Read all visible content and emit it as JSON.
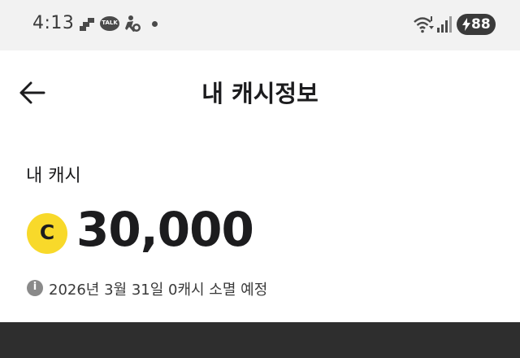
{
  "status_bar": {
    "time": "4:13",
    "talk_badge": "TALK",
    "battery": "88",
    "icons": [
      "blocks-icon",
      "kakaotalk-icon",
      "accessibility-icon",
      "notification-dot-icon",
      "wifi-icon",
      "signal-icon",
      "battery-charging-icon"
    ]
  },
  "header": {
    "title": "내 캐시정보",
    "back_icon": "arrow-left-icon"
  },
  "cash": {
    "label": "내 캐시",
    "coin_symbol": "C",
    "amount": "30,000",
    "coin_color": "#f8d92a"
  },
  "notice": {
    "info_symbol": "i",
    "text": "2026년 3월 31일 0캐시 소멸 예정"
  },
  "colors": {
    "status_bar_bg": "#f2f2f2",
    "bottom_panel_bg": "#2e2e2e"
  }
}
